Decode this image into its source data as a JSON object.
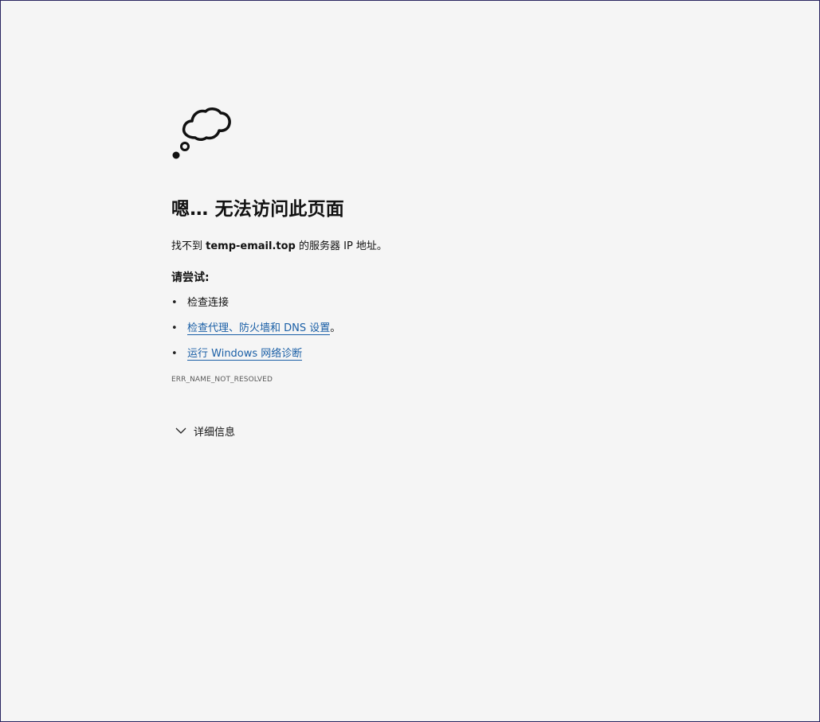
{
  "icons": {
    "thought_cloud": "thought-cloud-icon",
    "chevron": "chevron-down-icon"
  },
  "error_page": {
    "title": "嗯… 无法访问此页面",
    "message_prefix": "找不到 ",
    "host": "temp-email.top",
    "message_suffix": " 的服务器 IP 地址。",
    "try_label": "请尝试:",
    "suggestions": [
      {
        "text": "检查连接",
        "trailing": ""
      },
      {
        "text": "检查代理、防火墙和 DNS 设置",
        "trailing": "。"
      },
      {
        "text": "运行 Windows 网络诊断",
        "trailing": ""
      }
    ],
    "bullet": "•",
    "error_code": "ERR_NAME_NOT_RESOLVED",
    "details_label": "详细信息"
  },
  "colors": {
    "background": "#f5f5f5",
    "link": "#1a5fa6",
    "border": "#2a2660"
  }
}
